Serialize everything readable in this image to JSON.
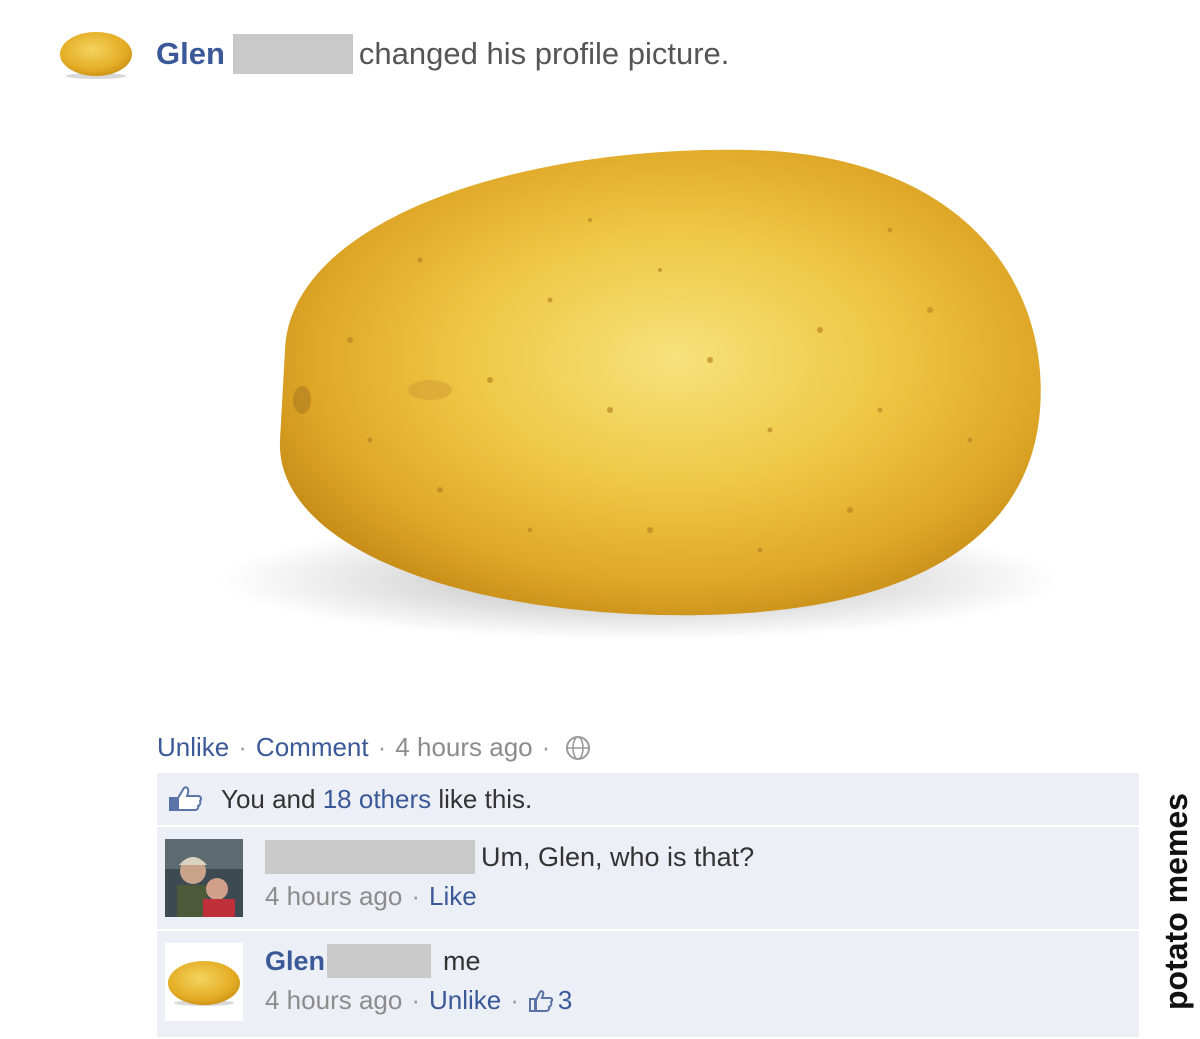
{
  "story": {
    "author_first": "Glen",
    "action_text": "changed his profile picture."
  },
  "actions": {
    "unlike": "Unlike",
    "separator": "·",
    "comment": "Comment",
    "timestamp": "4 hours ago",
    "privacy_icon": "globe-icon"
  },
  "likes": {
    "icon": "thumbs-up-icon",
    "prefix": "You and",
    "others_link": "18 others",
    "suffix": "like this."
  },
  "comments": [
    {
      "avatar": "friend-photo",
      "text": "Um, Glen, who is that?",
      "time": "4 hours ago",
      "action": "Like"
    },
    {
      "avatar": "potato-icon",
      "author_first": "Glen",
      "text": "me",
      "time": "4 hours ago",
      "action": "Unlike",
      "like_icon": "thumbs-up-icon",
      "like_count": "3"
    }
  ],
  "watermark": "potato memes",
  "colors": {
    "link": "#3b5998",
    "comment_bg": "#eceff5",
    "potato": "#e8b932",
    "redaction": "#c9c9c9"
  }
}
